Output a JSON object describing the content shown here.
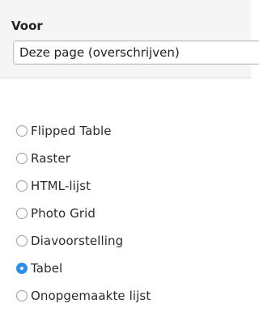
{
  "panel": {
    "label": "Voor",
    "select_value": "Deze page (overschrijven)"
  },
  "options": [
    {
      "label": "Flipped Table",
      "checked": false
    },
    {
      "label": "Raster",
      "checked": false
    },
    {
      "label": "HTML-lijst",
      "checked": false
    },
    {
      "label": "Photo Grid",
      "checked": false
    },
    {
      "label": "Diavoorstelling",
      "checked": false
    },
    {
      "label": "Tabel",
      "checked": true
    },
    {
      "label": "Onopgemaakte lijst",
      "checked": false
    }
  ],
  "colors": {
    "accent": "#2f8fe8"
  }
}
